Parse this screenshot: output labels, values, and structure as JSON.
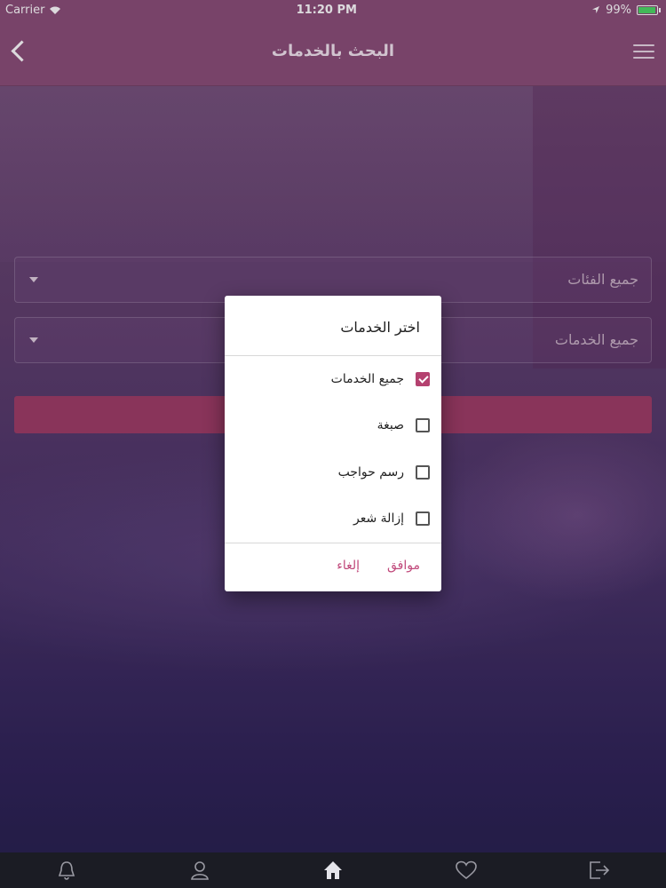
{
  "status_bar": {
    "carrier": "Carrier",
    "time": "11:20 PM",
    "battery": "99%"
  },
  "header": {
    "title": "البحث بالخدمات",
    "back_icon": "chevron-left-icon",
    "menu_icon": "hamburger-menu-icon"
  },
  "filters": {
    "category": "جميع الفئات",
    "service": "جميع الخدمات"
  },
  "dialog": {
    "title": "اختر الخدمات",
    "options": [
      {
        "label": "جميع الخدمات",
        "checked": true
      },
      {
        "label": "صبغة",
        "checked": false
      },
      {
        "label": "رسم حواجب",
        "checked": false
      },
      {
        "label": "إزالة شعر",
        "checked": false
      }
    ],
    "ok_label": "موافق",
    "cancel_label": "إلغاء",
    "accent_color": "#b4416f"
  },
  "tab_bar": {
    "icons": [
      "bell-icon",
      "user-icon",
      "home-icon",
      "heart-icon",
      "logout-icon"
    ]
  }
}
